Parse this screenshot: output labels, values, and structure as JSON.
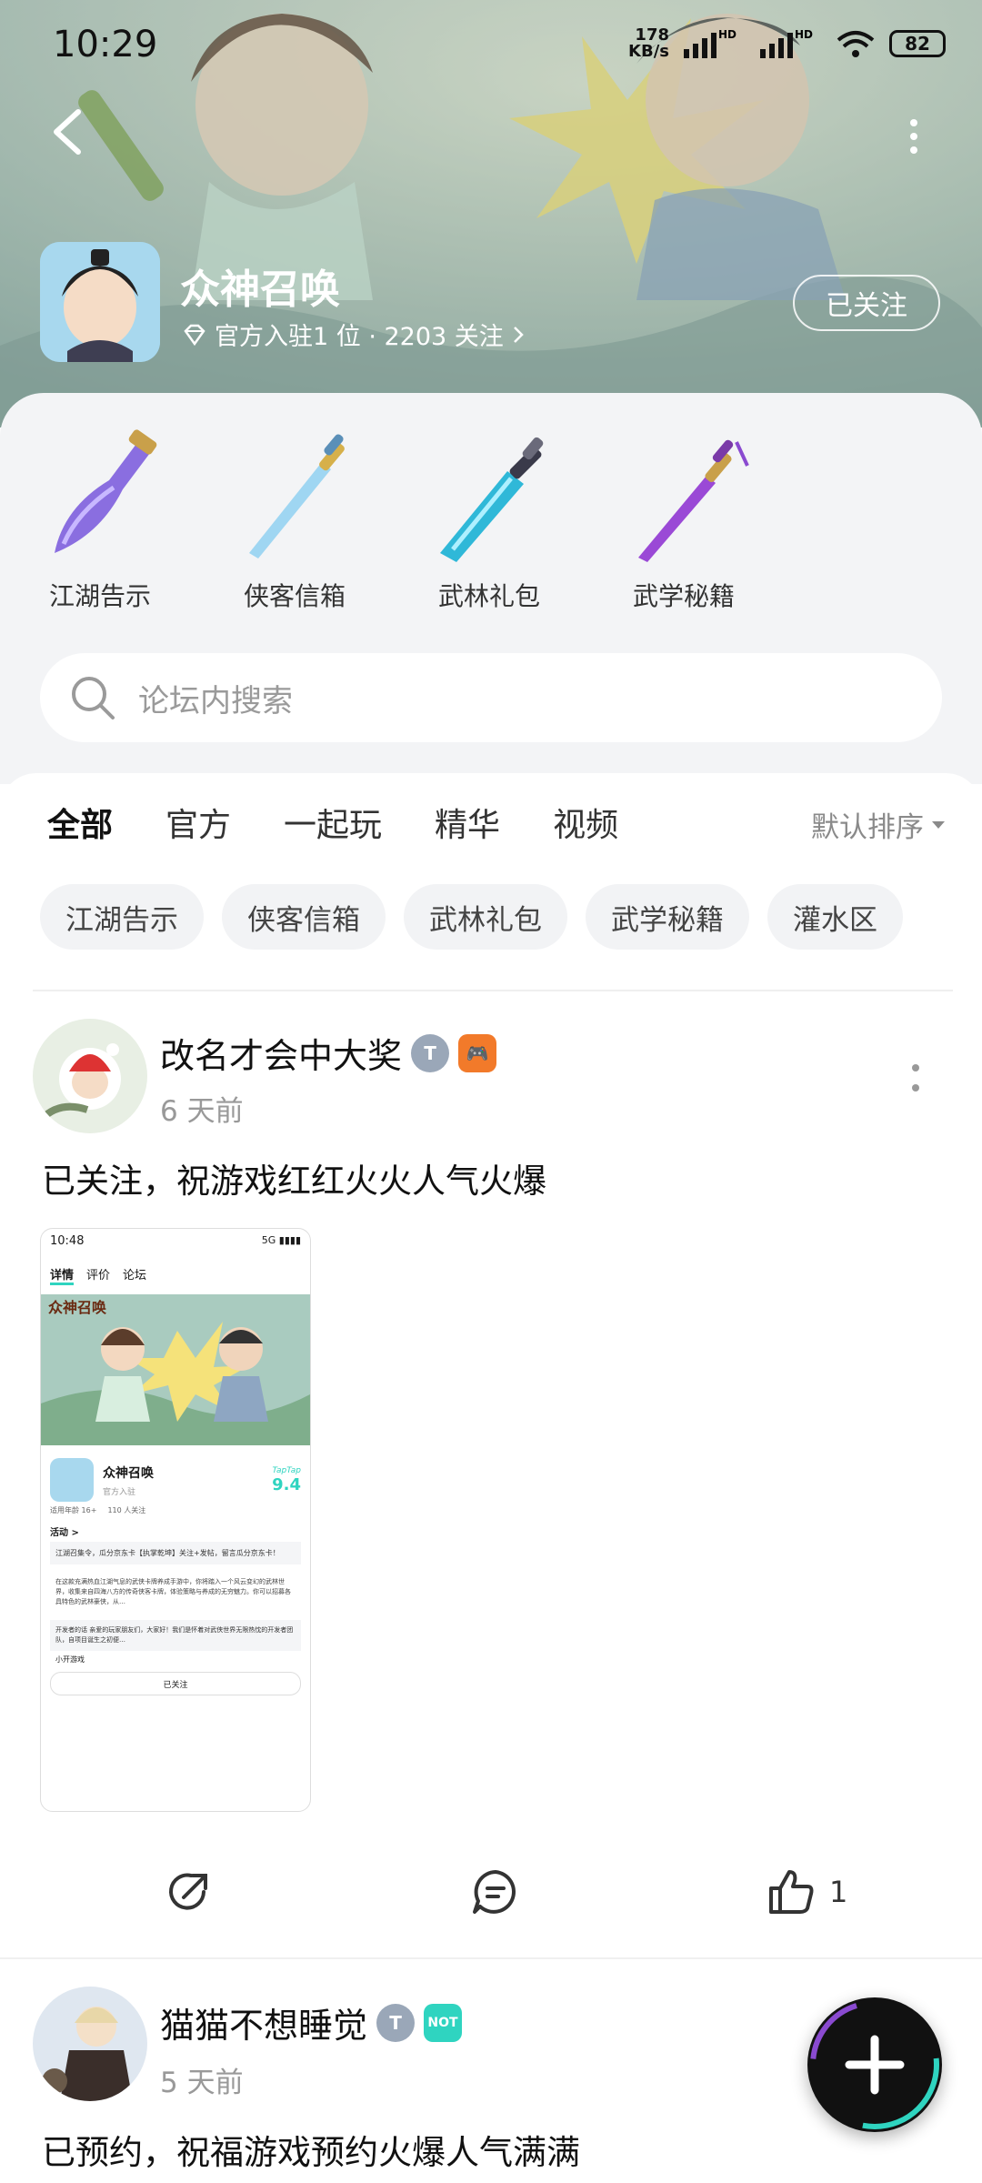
{
  "status_bar": {
    "time": "10:29",
    "net_speed": "178\nKB/s",
    "battery": "82"
  },
  "forum": {
    "title": "众神召唤",
    "meta": "官方入驻1 位 · 2203 关注",
    "follow_label": "已关注"
  },
  "categories": [
    {
      "label": "江湖告示",
      "color": "#7a5bd6"
    },
    {
      "label": "侠客信箱",
      "color": "#8fd0ef"
    },
    {
      "label": "武林礼包",
      "color": "#2fb8d8"
    },
    {
      "label": "武学秘籍",
      "color": "#9a49d6"
    }
  ],
  "search": {
    "placeholder": "论坛内搜索"
  },
  "tabs": [
    "全部",
    "官方",
    "一起玩",
    "精华",
    "视频"
  ],
  "sort_label": "默认排序",
  "chips": [
    "江湖告示",
    "侠客信箱",
    "武林礼包",
    "武学秘籍",
    "灌水区"
  ],
  "posts": [
    {
      "username": "改名才会中大奖",
      "time": "6 天前",
      "text": "已关注，祝游戏红红火火人气火爆",
      "like_count": "1",
      "screenshot": {
        "time": "10:48",
        "tabs": [
          "详情",
          "评价",
          "论坛"
        ],
        "game_name": "众神召唤",
        "score": "9.4",
        "score_brand": "TapTap",
        "tag": "官方入驻",
        "age": "适用年龄 16+",
        "players": "110 人关注",
        "activity": "活动 >",
        "notice": "江湖召集令，瓜分京东卡【执掌乾坤】关注+发帖，留言瓜分京东卡！",
        "intro": "在这款充满热血江湖气息的武侠卡牌养成手游中，你将踏入一个风云变幻的武林世界，收集来自四海八方的传奇侠客卡牌，体验策略与养成的无穷魅力。你可以招募各具特色的武林豪侠，从…",
        "dev": "开发者的话 亲爱的玩家朋友们，大家好！我们是怀着对武侠世界无限热忱的开发者团队，自项目诞生之初便…",
        "studio": "小开游戏",
        "follow": "已关注"
      }
    },
    {
      "username": "猫猫不想睡觉",
      "time": "5 天前",
      "text": "已预约，祝福游戏预约火爆人气满满"
    }
  ],
  "colors": {
    "accent": "#2fd4c0",
    "fab": "#111111"
  }
}
